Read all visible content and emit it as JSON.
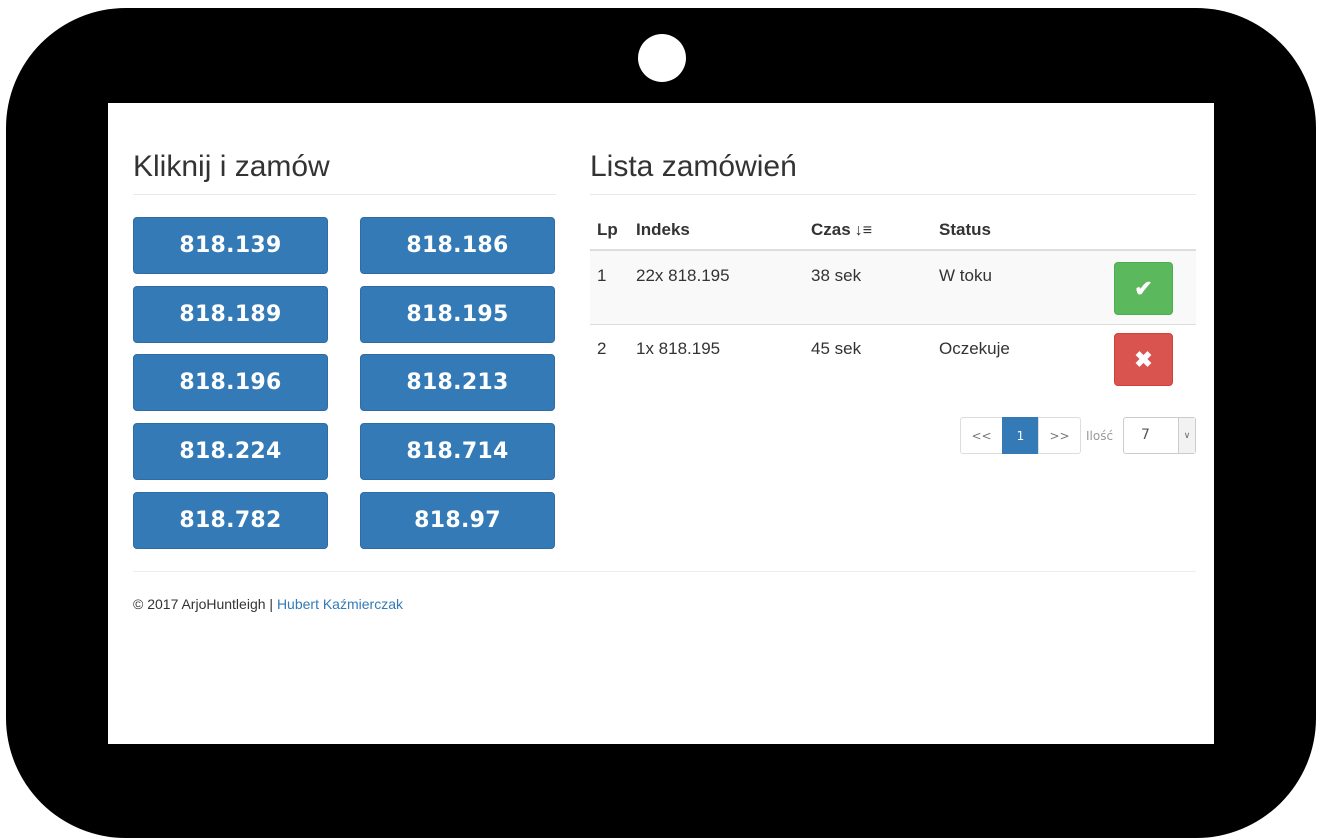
{
  "left_panel": {
    "title": "Kliknij i zamów",
    "buttons": [
      "818.139",
      "818.186",
      "818.189",
      "818.195",
      "818.196",
      "818.213",
      "818.224",
      "818.714",
      "818.782",
      "818.97"
    ]
  },
  "right_panel": {
    "title": "Lista zamówień",
    "columns": {
      "lp": "Lp",
      "index": "Indeks",
      "time": "Czas",
      "status": "Status"
    },
    "sort_icon": "sort-amount-desc-icon",
    "rows": [
      {
        "lp": "1",
        "index": "22x 818.195",
        "time": "38 sek",
        "status": "W toku",
        "action": "confirm"
      },
      {
        "lp": "2",
        "index": "1x 818.195",
        "time": "45 sek",
        "status": "Oczekuje",
        "action": "cancel"
      }
    ],
    "pagination": {
      "prev": "<<",
      "current": "1",
      "next": ">>"
    },
    "quantity": {
      "label": "Ilość",
      "value": "7"
    }
  },
  "footer": {
    "copyright": "© 2017 ArjoHuntleigh |",
    "author": "Hubert Kaźmierczak"
  },
  "colors": {
    "primary": "#337ab7",
    "success": "#5cb85c",
    "danger": "#d9534f",
    "frame": "#000000"
  }
}
